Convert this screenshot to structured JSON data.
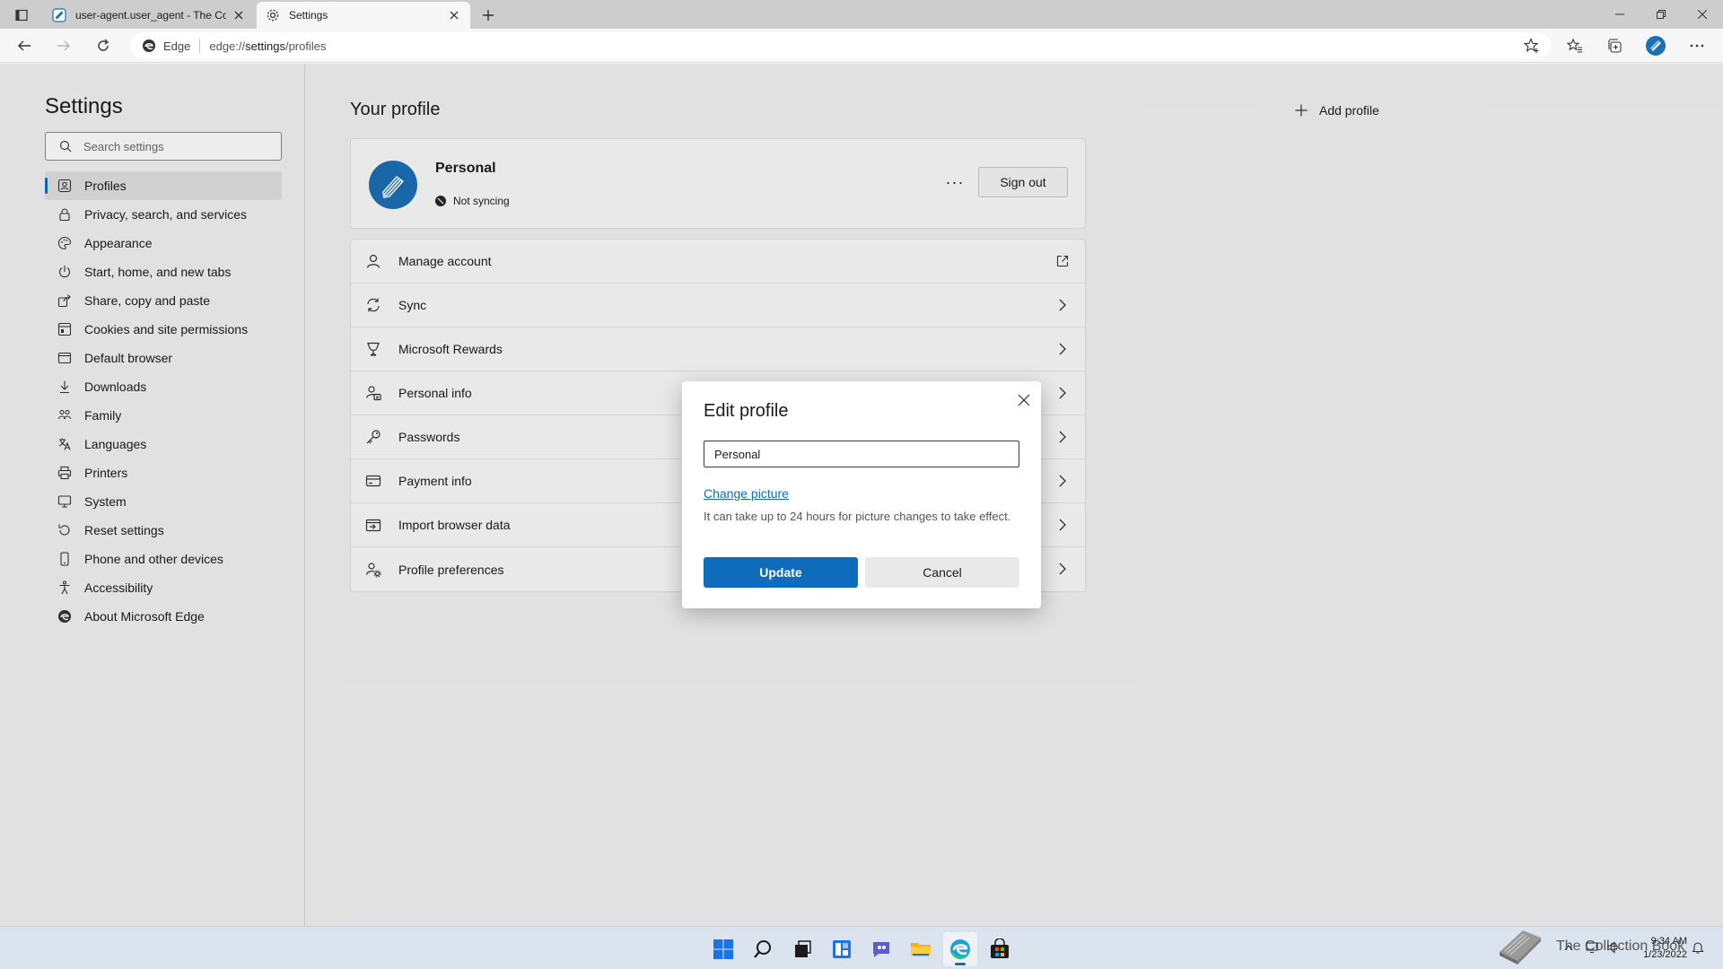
{
  "browser": {
    "tabs": [
      {
        "title": "user-agent.user_agent - The Co",
        "favicon": "book-icon",
        "active": false
      },
      {
        "title": "Settings",
        "favicon": "gear-icon",
        "active": true
      }
    ],
    "address": {
      "site_name": "Edge",
      "url_prefix": "edge://",
      "url_main": "settings",
      "url_suffix": "/profiles"
    }
  },
  "sidebar": {
    "title": "Settings",
    "search_placeholder": "Search settings",
    "items": [
      {
        "label": "Profiles",
        "icon": "profile-icon",
        "active": true
      },
      {
        "label": "Privacy, search, and services",
        "icon": "lock-icon"
      },
      {
        "label": "Appearance",
        "icon": "appearance-icon"
      },
      {
        "label": "Start, home, and new tabs",
        "icon": "power-icon"
      },
      {
        "label": "Share, copy and paste",
        "icon": "share-icon"
      },
      {
        "label": "Cookies and site permissions",
        "icon": "cookie-icon"
      },
      {
        "label": "Default browser",
        "icon": "browser-icon"
      },
      {
        "label": "Downloads",
        "icon": "download-icon"
      },
      {
        "label": "Family",
        "icon": "family-icon"
      },
      {
        "label": "Languages",
        "icon": "language-icon"
      },
      {
        "label": "Printers",
        "icon": "printer-icon"
      },
      {
        "label": "System",
        "icon": "system-icon"
      },
      {
        "label": "Reset settings",
        "icon": "reset-icon"
      },
      {
        "label": "Phone and other devices",
        "icon": "phone-icon"
      },
      {
        "label": "Accessibility",
        "icon": "accessibility-icon"
      },
      {
        "label": "About Microsoft Edge",
        "icon": "edge-icon"
      }
    ]
  },
  "main": {
    "heading": "Your profile",
    "add_profile": "Add profile",
    "profile": {
      "name": "Personal",
      "sync_status": "Not syncing",
      "more": "···",
      "sign_out": "Sign out"
    },
    "rows": [
      {
        "label": "Manage account",
        "icon": "person-icon",
        "trailing": "external-link-icon"
      },
      {
        "label": "Sync",
        "icon": "sync-icon",
        "trailing": "chevron-right-icon"
      },
      {
        "label": "Microsoft Rewards",
        "icon": "trophy-icon",
        "trailing": "chevron-right-icon"
      },
      {
        "label": "Personal info",
        "icon": "personal-info-icon",
        "trailing": "chevron-right-icon"
      },
      {
        "label": "Passwords",
        "icon": "key-icon",
        "trailing": "chevron-right-icon"
      },
      {
        "label": "Payment info",
        "icon": "card-icon",
        "trailing": "chevron-right-icon"
      },
      {
        "label": "Import browser data",
        "icon": "import-icon",
        "trailing": "chevron-right-icon"
      },
      {
        "label": "Profile preferences",
        "icon": "profile-prefs-icon",
        "trailing": "chevron-right-icon"
      }
    ]
  },
  "dialog": {
    "title": "Edit profile",
    "name_value": "Personal",
    "change_picture": "Change picture",
    "note": "It can take up to 24 hours for picture changes to take effect.",
    "update": "Update",
    "cancel": "Cancel"
  },
  "taskbar": {
    "apps": [
      "windows-start-icon",
      "search-icon",
      "task-view-icon",
      "widgets-icon",
      "chat-icon",
      "file-explorer-icon",
      "edge-icon",
      "store-icon"
    ],
    "active_app": "edge-icon",
    "watermark_text": "The Collection Book",
    "time": "9:34 AM",
    "date": "1/23/2022"
  },
  "colors": {
    "accent": "#0f6cbd",
    "avatar": "#1b6fb5"
  }
}
